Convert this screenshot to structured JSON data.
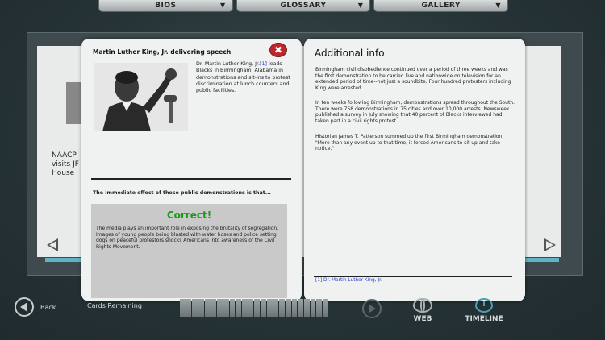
{
  "nav": {
    "items": [
      {
        "label": "BIOS"
      },
      {
        "label": "GLOSSARY"
      },
      {
        "label": "GALLERY"
      }
    ]
  },
  "background_card": {
    "peek_text": "NAACP visits JF House"
  },
  "card": {
    "title": "Martin Luther King, Jr. delivering speech",
    "description_pre": "Dr. Martin Luther King, Jr.",
    "description_ref": "[1]",
    "description_post": " leads Blacks in Birmingham, Alabama in demonstrations and sit-ins to protest discrimination at lunch counters and public facilities.",
    "question": "The immediate effect of these public demonstrations is that...",
    "result": "Correct!",
    "answer": "The media plays an important role in exposing the brutality of segregation. Images of young people being blasted with water hoses and police setting dogs on peaceful protestors shocks Americans into awareness of the Civil Rights Movement."
  },
  "info": {
    "title": "Additional info",
    "paragraphs": [
      "Birmingham civil disobedience continued over a period of three weeks and was the first demonstration to be carried live and nationwide on television for an extended period of time--not just a soundbite. Four hundred protesters including King were arrested.",
      "In ten weeks following Birmingham, demonstrations spread throughout the South. There were 758 demonstrations in 75 cities and over 10,000 arrests. Newsweek published a survey in July showing that 40 percent of Blacks interviewed had taken part in a civil rights protest.",
      "Historian James T. Patterson summed up the first Birmingham demonstration, \"More than any event up to that time, it forced Americans to sit up and take notice.\""
    ],
    "reference": "[1] Dr. Martin Luther King, Jr."
  },
  "bottom": {
    "back_label": "Back",
    "cards_remaining_label": "Cards Remaining",
    "web_label": "WEB",
    "timeline_label": "TIMELINE"
  },
  "colors": {
    "accent_teal": "#4c9fb3",
    "correct_green": "#1c9a1c",
    "close_red": "#c0272d",
    "link_blue": "#2b3ec9"
  }
}
